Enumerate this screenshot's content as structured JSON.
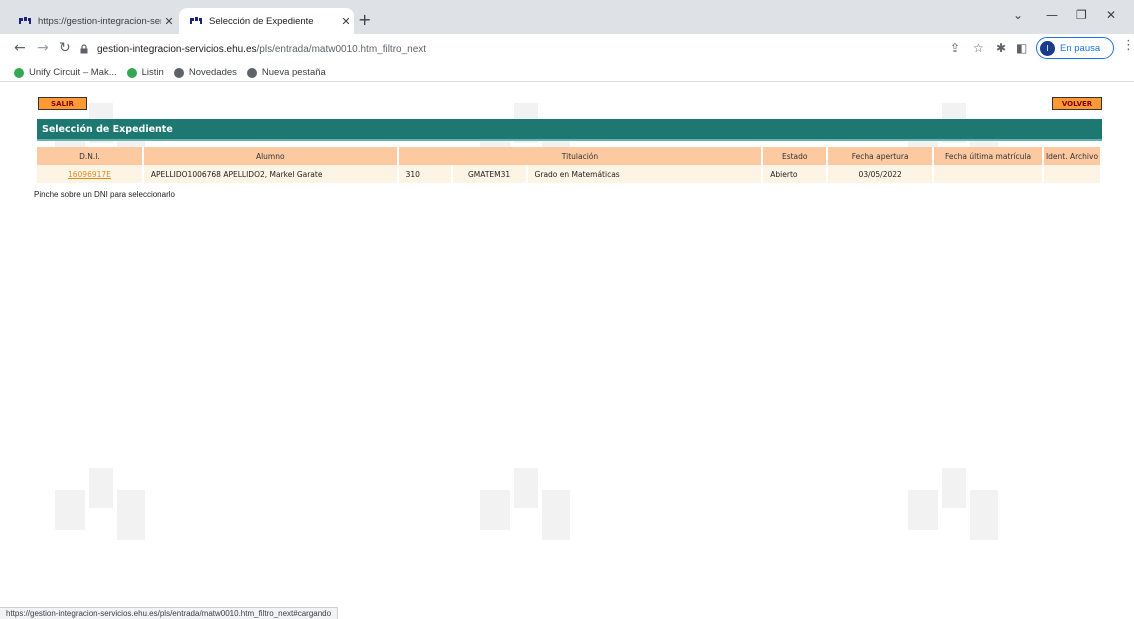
{
  "browser": {
    "tabs": [
      {
        "title": "https://gestion-integracion-servi",
        "active": false
      },
      {
        "title": "Selección de Expediente",
        "active": true
      }
    ],
    "url_host": "gestion-integracion-servicios.ehu.es",
    "url_path": "/pls/entrada/matw0010.htm_filtro_next",
    "profile_initial": "I",
    "profile_status": "En pausa",
    "bookmarks": [
      {
        "label": "Unify Circuit – Mak...",
        "icon": "green-circle-icon"
      },
      {
        "label": "Listin",
        "icon": "green-circle-icon"
      },
      {
        "label": "Novedades",
        "icon": "globe-icon"
      },
      {
        "label": "Nueva pestaña",
        "icon": "globe-icon"
      }
    ],
    "status_url": "https://gestion-integracion-servicios.ehu.es/pls/entrada/matw0010.htm_filtro_next#cargando"
  },
  "page": {
    "salir_label": "SALIR",
    "volver_label": "VOLVER",
    "title": "Selección de Expediente",
    "columns": [
      "D.N.I.",
      "Alumno",
      "Titulación",
      "Estado",
      "Fecha apertura",
      "Fecha última matrícula",
      "Ident. Archivo"
    ],
    "rows": [
      {
        "dni": "16096917E",
        "alumno": "APELLIDO1006768 APELLIDO2, Markel Garate",
        "tit_code": "310",
        "tit_plan": "GMATEM31",
        "tit_name": "Grado en Matemáticas",
        "estado": "Abierto",
        "fecha_apertura": "03/05/2022",
        "fecha_ultima": "",
        "ident_archivo": ""
      }
    ],
    "hint": "Pinche sobre un DNI para seleccionarlo"
  },
  "colors": {
    "header_bar": "#1d7872",
    "table_header": "#fdc9a1",
    "table_row": "#fef4e6",
    "button": "#ff9933",
    "link": "#e08a1e"
  }
}
